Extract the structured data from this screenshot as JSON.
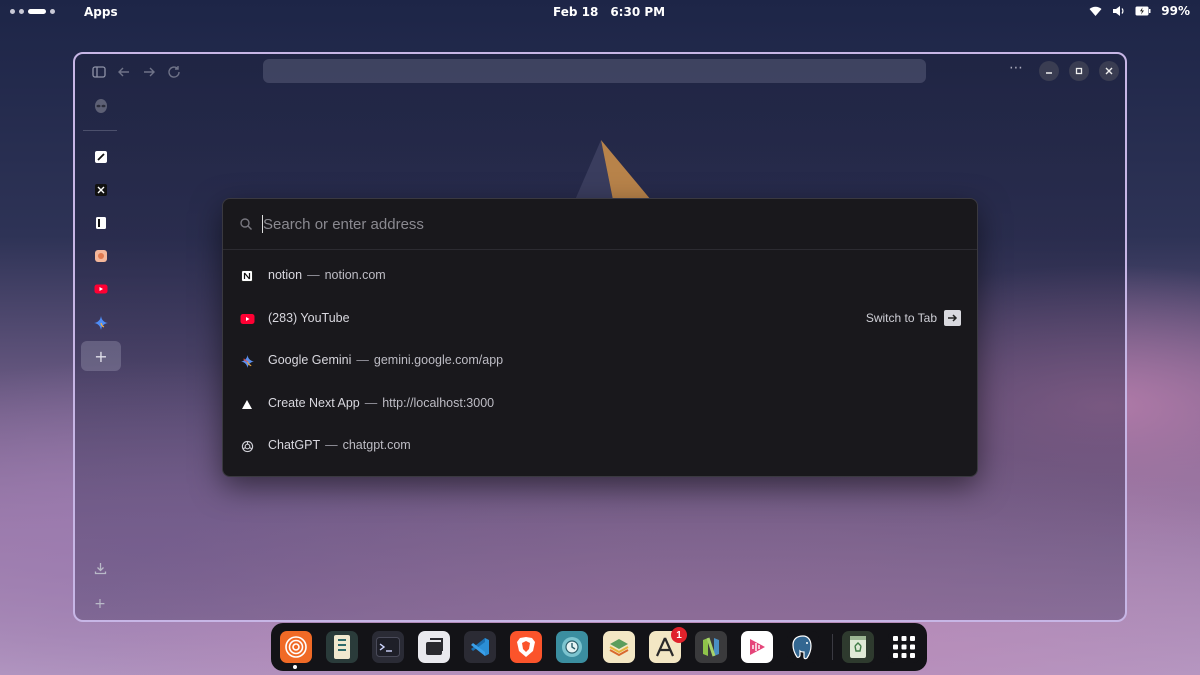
{
  "topbar": {
    "apps_label": "Apps",
    "date": "Feb 18",
    "time": "6:30 PM",
    "battery": "99%"
  },
  "window": {
    "toolbar": {
      "icons": [
        "sidebar-toggle-icon",
        "back-arrow-icon",
        "forward-arrow-icon",
        "reload-icon"
      ],
      "more_label": "⋯"
    },
    "sidebar": {
      "top_icon": "alien-icon",
      "pinned": [
        {
          "name": "perplexity-favicon",
          "color": "#ffffff"
        },
        {
          "name": "x-favicon",
          "color": "#ffffff"
        },
        {
          "name": "notion-favicon",
          "color": "#ffffff"
        },
        {
          "name": "claude-favicon",
          "color": "#f5a07a"
        },
        {
          "name": "youtube-favicon",
          "color": "#ff0033"
        },
        {
          "name": "gemini-favicon",
          "color": "#4e8cf5"
        }
      ],
      "add_label": "+",
      "bottom_add_label": "+"
    }
  },
  "palette": {
    "placeholder": "Search or enter address",
    "results": [
      {
        "title": "notion",
        "sep": "—",
        "url": "notion.com",
        "icon": "notion-icon"
      },
      {
        "title": "(283) YouTube",
        "sep": "",
        "url": "",
        "icon": "youtube-icon",
        "action": "Switch to Tab"
      },
      {
        "title": "Google Gemini",
        "sep": "—",
        "url": "gemini.google.com/app",
        "icon": "gemini-icon"
      },
      {
        "title": "Create Next App",
        "sep": "—",
        "url": "http://localhost:3000",
        "icon": "vercel-triangle-icon"
      },
      {
        "title": "ChatGPT",
        "sep": "—",
        "url": "chatgpt.com",
        "icon": "chatgpt-icon"
      }
    ]
  },
  "dock": {
    "apps": [
      {
        "name": "zen-browser",
        "color": "#f06a26",
        "running": true
      },
      {
        "name": "file-manager",
        "color": "#f0ead8"
      },
      {
        "name": "terminal",
        "color": "#2c2d36"
      },
      {
        "name": "screenshot-tool",
        "color": "#e6e6ea"
      },
      {
        "name": "vscode",
        "color": "#2f2f38"
      },
      {
        "name": "brave",
        "color": "#fb542b"
      },
      {
        "name": "timeshift",
        "color": "#4aa3b5"
      },
      {
        "name": "layers-app",
        "color": "#f2e6c2"
      },
      {
        "name": "app-store",
        "color": "#f2e6c2",
        "badge": "1"
      },
      {
        "name": "neovim-app",
        "color": "#3a3a3a"
      },
      {
        "name": "audio-player",
        "color": "#ffffff"
      },
      {
        "name": "postgresql",
        "color": "#336791"
      },
      {
        "name": "trash",
        "color": "#dfe9d6"
      },
      {
        "name": "app-grid",
        "color": "#131317"
      }
    ]
  }
}
